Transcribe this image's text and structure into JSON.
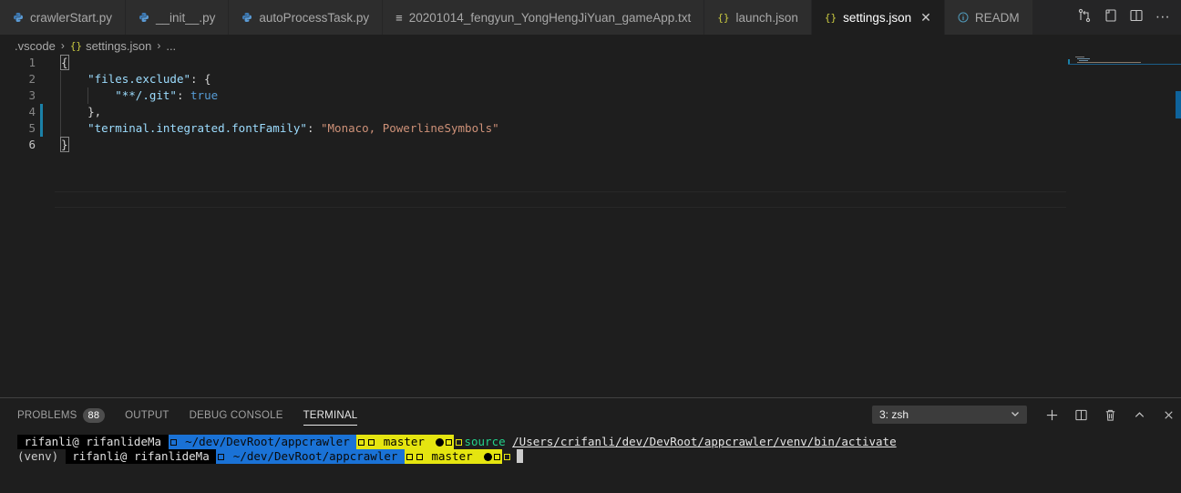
{
  "tabs": [
    {
      "label": "crawlerStart.py",
      "icon": "python-icon",
      "active": false
    },
    {
      "label": "__init__.py",
      "icon": "python-icon",
      "active": false
    },
    {
      "label": "autoProcessTask.py",
      "icon": "python-icon",
      "active": false
    },
    {
      "label": "20201014_fengyun_YongHengJiYuan_gameApp.txt",
      "icon": "text-file-icon",
      "active": false
    },
    {
      "label": "launch.json",
      "icon": "json-icon",
      "active": false
    },
    {
      "label": "settings.json",
      "icon": "json-icon",
      "active": true
    },
    {
      "label": "READM",
      "icon": "info-icon",
      "active": false
    }
  ],
  "breadcrumb": {
    "folder": ".vscode",
    "file": "settings.json",
    "more": "..."
  },
  "editor": {
    "lines": [
      {
        "num": "1",
        "parts": [
          {
            "t": "{",
            "c": "p"
          }
        ]
      },
      {
        "num": "2",
        "parts": [
          {
            "t": "    ",
            "c": "p"
          },
          {
            "t": "\"files.exclude\"",
            "c": "k"
          },
          {
            "t": ": {",
            "c": "p"
          }
        ]
      },
      {
        "num": "3",
        "parts": [
          {
            "t": "        ",
            "c": "p"
          },
          {
            "t": "\"**/.git\"",
            "c": "k"
          },
          {
            "t": ": ",
            "c": "p"
          },
          {
            "t": "true",
            "c": "b"
          }
        ]
      },
      {
        "num": "4",
        "parts": [
          {
            "t": "    },",
            "c": "p"
          }
        ]
      },
      {
        "num": "5",
        "parts": [
          {
            "t": "    ",
            "c": "p"
          },
          {
            "t": "\"terminal.integrated.fontFamily\"",
            "c": "k"
          },
          {
            "t": ": ",
            "c": "p"
          },
          {
            "t": "\"Monaco, PowerlineSymbols\"",
            "c": "s"
          }
        ]
      },
      {
        "num": "6",
        "parts": [
          {
            "t": "}",
            "c": "p"
          }
        ]
      }
    ]
  },
  "panel": {
    "tabs": {
      "problems": "PROBLEMS",
      "problems_count": "88",
      "output": "OUTPUT",
      "debug": "DEBUG CONSOLE",
      "terminal": "TERMINAL"
    },
    "terminal_select": "3: zsh"
  },
  "terminal": {
    "line1": {
      "user": " rifanli@ rifanlideMa ",
      "dir": " ~/dev/DevRoot/appcrawler ",
      "branch": " master ",
      "cmd": "source",
      "path": "/Users/crifanli/dev/DevRoot/appcrawler/venv/bin/activate"
    },
    "line2": {
      "venv": "(venv) ",
      "user": " rifanli@ rifanlideMa ",
      "dir": " ~/dev/DevRoot/appcrawler ",
      "branch": " master "
    }
  },
  "colors": {
    "accent": "#0e639c",
    "json_key": "#9cdcfe",
    "json_string": "#ce9178",
    "json_bool": "#569cd6",
    "prompt_blue": "#1a72d6",
    "prompt_yellow": "#e5e510"
  }
}
